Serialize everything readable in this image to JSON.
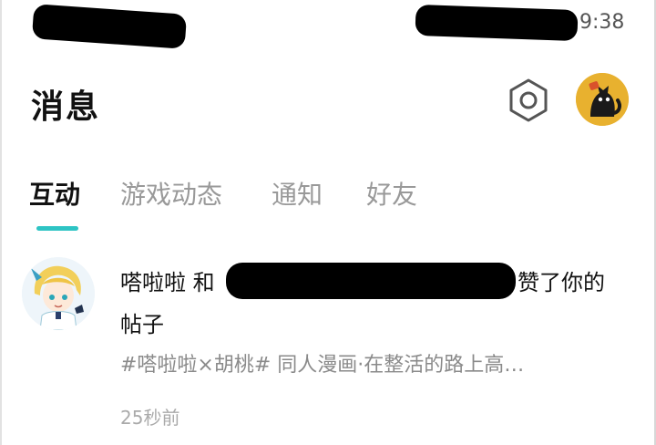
{
  "status_bar": {
    "time": "9:38"
  },
  "header": {
    "title": "消息"
  },
  "tabs": [
    {
      "label": "互动",
      "active": true
    },
    {
      "label": "游戏动态",
      "active": false
    },
    {
      "label": "通知",
      "active": false
    },
    {
      "label": "好友",
      "active": false
    }
  ],
  "notification": {
    "line1_start": "嗒啦啦 和",
    "line1_end": "赞了你的",
    "line2": "帖子",
    "preview": "#嗒啦啦×胡桃# 同人漫画·在整活的路上高…",
    "time": "25秒前"
  },
  "colors": {
    "tab_indicator": "#2ec4c4",
    "avatar_bg": "#e8b12f"
  }
}
